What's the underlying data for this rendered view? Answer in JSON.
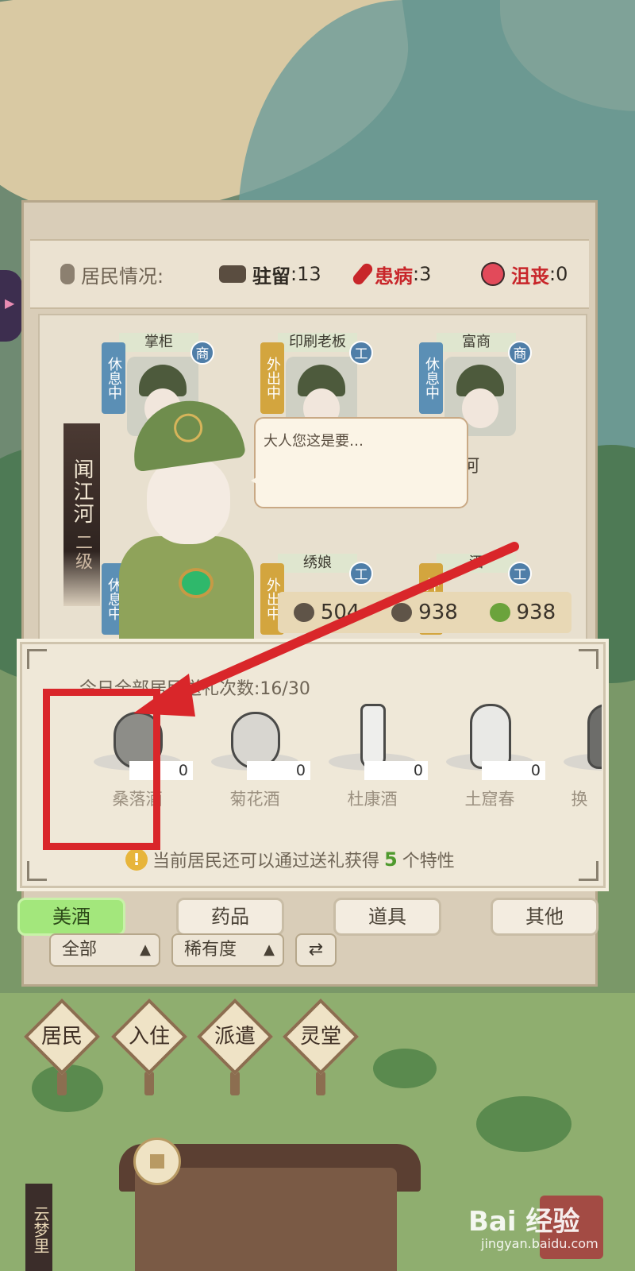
{
  "status": {
    "residents_label": "居民情况:",
    "stay_label": "驻留",
    "stay_value": ":13",
    "sick_label": "患病",
    "sick_value": ":3",
    "depressed_label": "沮丧",
    "depressed_value": ":0"
  },
  "residents": [
    {
      "role": "掌柜",
      "state": "休息中",
      "badge": "商",
      "name": ""
    },
    {
      "role": "印刷老板",
      "state": "外出中",
      "badge": "工",
      "name": ""
    },
    {
      "role": "富商",
      "state": "休息中",
      "badge": "商",
      "name": "江河"
    },
    {
      "role": "",
      "state": "休息中",
      "badge": "",
      "name": ""
    },
    {
      "role": "绣娘",
      "state": "外出中",
      "badge": "工",
      "name": ""
    },
    {
      "role": "酒",
      "state": "外出中",
      "badge": "工",
      "name": ""
    }
  ],
  "selected_resident": {
    "name": "闻江河",
    "level": "二级"
  },
  "speech": "大人您这是要…",
  "stats": {
    "first": "504",
    "second": "938",
    "third": "938"
  },
  "gift_panel": {
    "count_text": "今日全部居民送礼次数:16/30",
    "gifts": [
      {
        "name": "桑落酒",
        "qty": "0"
      },
      {
        "name": "菊花酒",
        "qty": "0"
      },
      {
        "name": "杜康酒",
        "qty": "0"
      },
      {
        "name": "土窟春",
        "qty": "0"
      },
      {
        "name": "换",
        "qty": ""
      }
    ],
    "hint_prefix": "当前居民还可以通过送礼获得",
    "hint_number": "5",
    "hint_suffix": "个特性"
  },
  "tabs": [
    "美酒",
    "药品",
    "道具",
    "其他"
  ],
  "filters": {
    "all": "全部",
    "rarity": "稀有度",
    "sort_icon": "⇄"
  },
  "nav": [
    "居民",
    "入住",
    "派遣",
    "灵堂"
  ],
  "scene": {
    "village_sign": "云梦里"
  },
  "watermark": {
    "logo": "Bai 经验",
    "url": "jingyan.baidu.com"
  },
  "colors": {
    "active_tab": "#a3e77c",
    "highlight": "#d9262a",
    "sick": "#c8262a",
    "depressed": "#c8262a"
  }
}
